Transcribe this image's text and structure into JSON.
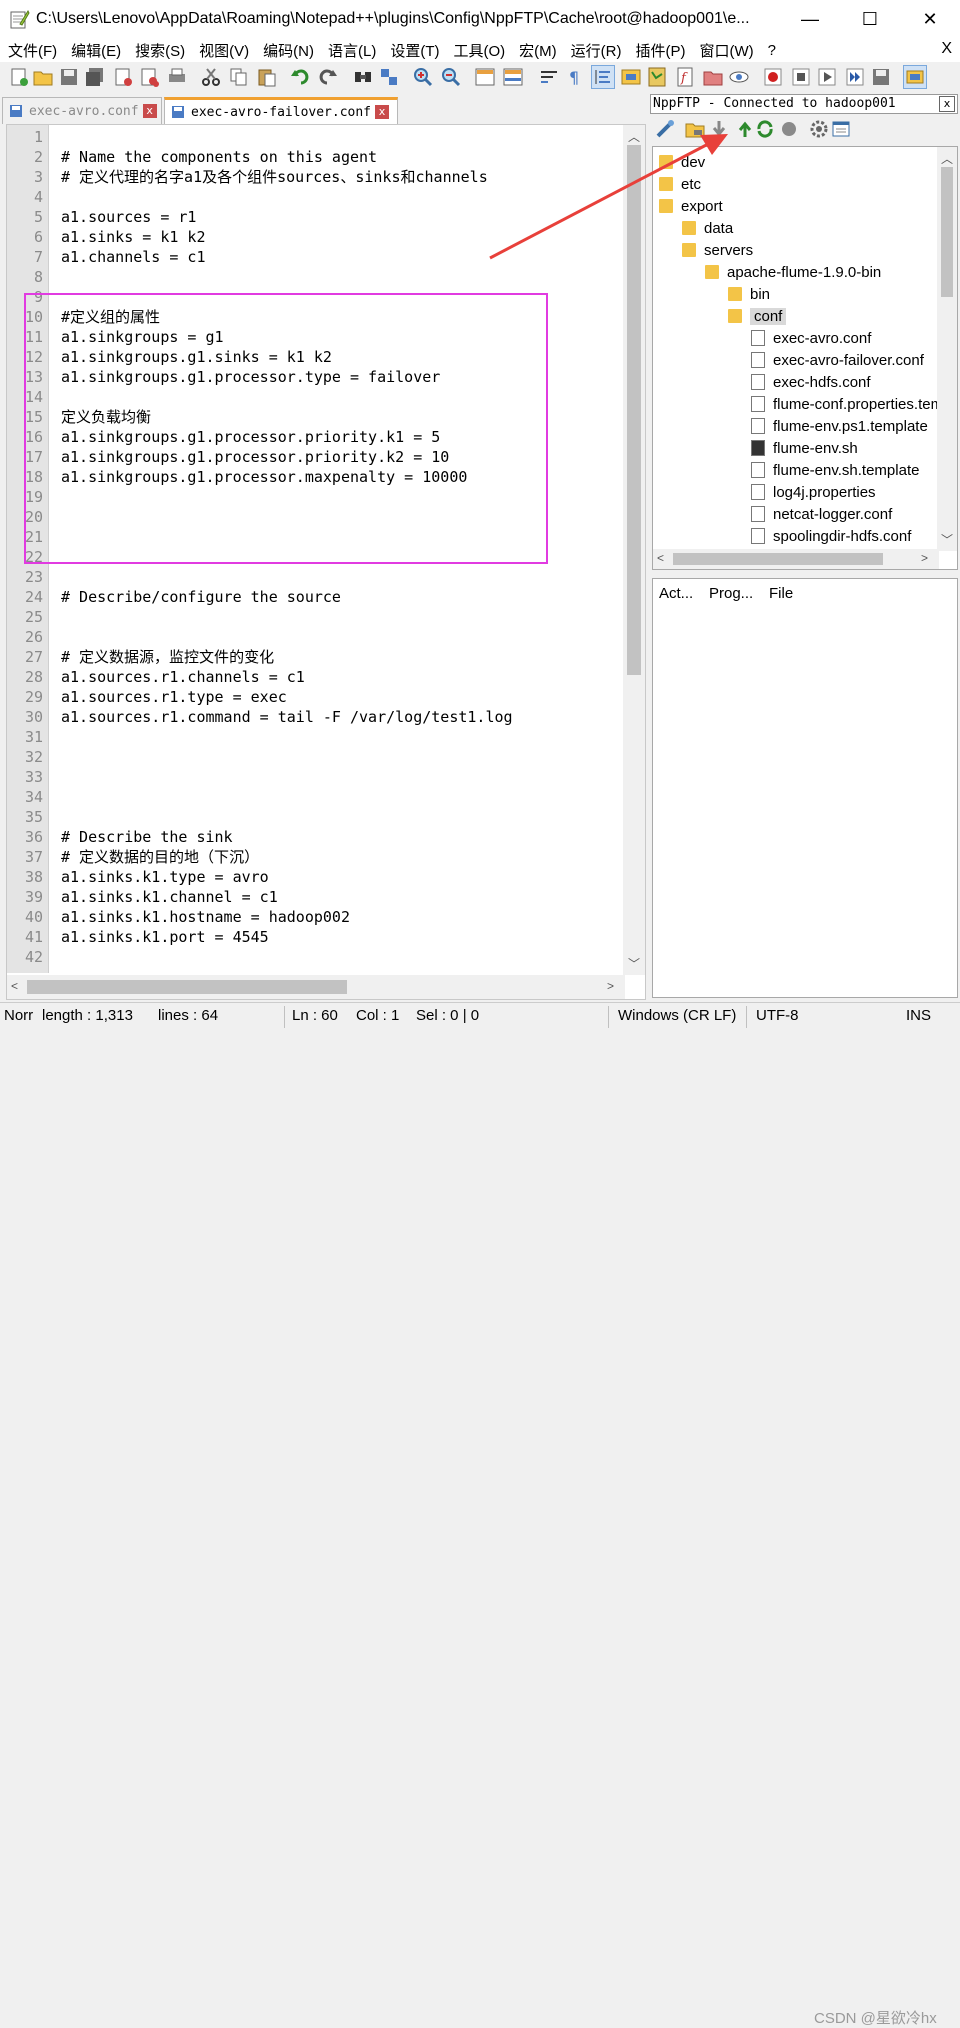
{
  "window": {
    "title": "C:\\Users\\Lenovo\\AppData\\Roaming\\Notepad++\\plugins\\Config\\NppFTP\\Cache\\root@hadoop001\\e...",
    "minimize": "—",
    "maximize": "☐",
    "close": "✕"
  },
  "menu": {
    "items": [
      "文件(F)",
      "编辑(E)",
      "搜索(S)",
      "视图(V)",
      "编码(N)",
      "语言(L)",
      "设置(T)",
      "工具(O)",
      "宏(M)",
      "运行(R)",
      "插件(P)",
      "窗口(W)",
      "?"
    ],
    "close_doc": "X"
  },
  "tabs": [
    {
      "label": "exec-avro.conf",
      "close": "x"
    },
    {
      "label": "exec-avro-failover.conf",
      "close": "x"
    }
  ],
  "editor": {
    "lines": [
      {
        "n": "1",
        "text": ""
      },
      {
        "n": "2",
        "text": "# Name the components on this agent"
      },
      {
        "n": "3",
        "text": "# 定义代理的名字a1及各个组件sources、sinks和channels"
      },
      {
        "n": "4",
        "text": ""
      },
      {
        "n": "5",
        "text": "a1.sources = r1"
      },
      {
        "n": "6",
        "text": "a1.sinks = k1 k2"
      },
      {
        "n": "7",
        "text": "a1.channels = c1"
      },
      {
        "n": "8",
        "text": ""
      },
      {
        "n": "9",
        "text": ""
      },
      {
        "n": "10",
        "text": "#定义组的属性"
      },
      {
        "n": "11",
        "text": "a1.sinkgroups = g1"
      },
      {
        "n": "12",
        "text": "a1.sinkgroups.g1.sinks = k1 k2"
      },
      {
        "n": "13",
        "text": "a1.sinkgroups.g1.processor.type = failover"
      },
      {
        "n": "14",
        "text": ""
      },
      {
        "n": "15",
        "text": "定义负载均衡"
      },
      {
        "n": "16",
        "text": "a1.sinkgroups.g1.processor.priority.k1 = 5"
      },
      {
        "n": "17",
        "text": "a1.sinkgroups.g1.processor.priority.k2 = 10"
      },
      {
        "n": "18",
        "text": "a1.sinkgroups.g1.processor.maxpenalty = 10000"
      },
      {
        "n": "19",
        "text": ""
      },
      {
        "n": "20",
        "text": ""
      },
      {
        "n": "21",
        "text": ""
      },
      {
        "n": "22",
        "text": ""
      },
      {
        "n": "23",
        "text": ""
      },
      {
        "n": "24",
        "text": "# Describe/configure the source"
      },
      {
        "n": "25",
        "text": ""
      },
      {
        "n": "26",
        "text": ""
      },
      {
        "n": "27",
        "text": "# 定义数据源，监控文件的变化"
      },
      {
        "n": "28",
        "text": "a1.sources.r1.channels = c1"
      },
      {
        "n": "29",
        "text": "a1.sources.r1.type = exec"
      },
      {
        "n": "30",
        "text": "a1.sources.r1.command = tail -F /var/log/test1.log"
      },
      {
        "n": "31",
        "text": ""
      },
      {
        "n": "32",
        "text": ""
      },
      {
        "n": "33",
        "text": ""
      },
      {
        "n": "34",
        "text": ""
      },
      {
        "n": "35",
        "text": ""
      },
      {
        "n": "36",
        "text": "# Describe the sink"
      },
      {
        "n": "37",
        "text": "# 定义数据的目的地（下沉）"
      },
      {
        "n": "38",
        "text": "a1.sinks.k1.type = avro"
      },
      {
        "n": "39",
        "text": "a1.sinks.k1.channel = c1"
      },
      {
        "n": "40",
        "text": "a1.sinks.k1.hostname = hadoop002"
      },
      {
        "n": "41",
        "text": "a1.sinks.k1.port = 4545"
      },
      {
        "n": "42",
        "text": ""
      }
    ]
  },
  "ftp": {
    "header": "NppFTP - Connected to hadoop001",
    "close": "x",
    "tree": [
      {
        "label": "dev",
        "type": "folder",
        "depth": 0
      },
      {
        "label": "etc",
        "type": "folder",
        "depth": 0
      },
      {
        "label": "export",
        "type": "folder",
        "depth": 0
      },
      {
        "label": "data",
        "type": "folder",
        "depth": 1
      },
      {
        "label": "servers",
        "type": "folder",
        "depth": 1
      },
      {
        "label": "apache-flume-1.9.0-bin",
        "type": "folder",
        "depth": 2
      },
      {
        "label": "bin",
        "type": "folder",
        "depth": 3
      },
      {
        "label": "conf",
        "type": "folder",
        "depth": 3,
        "selected": true
      },
      {
        "label": "exec-avro.conf",
        "type": "file",
        "depth": 4
      },
      {
        "label": "exec-avro-failover.conf",
        "type": "file",
        "depth": 4
      },
      {
        "label": "exec-hdfs.conf",
        "type": "file",
        "depth": 4
      },
      {
        "label": "flume-conf.properties.template",
        "type": "file",
        "depth": 4
      },
      {
        "label": "flume-env.ps1.template",
        "type": "file",
        "depth": 4
      },
      {
        "label": "flume-env.sh",
        "type": "file-dark",
        "depth": 4
      },
      {
        "label": "flume-env.sh.template",
        "type": "file",
        "depth": 4
      },
      {
        "label": "log4j.properties",
        "type": "file",
        "depth": 4
      },
      {
        "label": "netcat-logger.conf",
        "type": "file",
        "depth": 4
      },
      {
        "label": "spoolingdir-hdfs.conf",
        "type": "file",
        "depth": 4
      }
    ],
    "queue_headers": [
      "Act...",
      "Prog...",
      "File"
    ]
  },
  "status": {
    "type": "Norr",
    "length": "length : 1,313",
    "lines": "lines : 64",
    "ln": "Ln : 60",
    "col": "Col : 1",
    "sel": "Sel : 0 | 0",
    "eol": "Windows (CR LF)",
    "encoding": "UTF-8",
    "mode": "INS",
    "watermark": "CSDN @星欲冷hx"
  },
  "colors": {
    "highlight_box": "#e13be1",
    "annotation_arrow": "#e8403a",
    "folder": "#f3c447"
  }
}
